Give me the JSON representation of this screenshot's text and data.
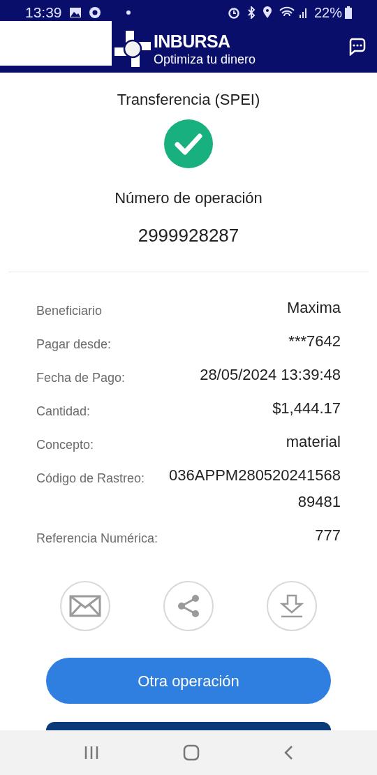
{
  "status_bar": {
    "time": "13:39",
    "battery": "22%"
  },
  "header": {
    "brand": "INBURSA",
    "tagline": "Optimiza tu dinero"
  },
  "receipt": {
    "title": "Transferencia (SPEI)",
    "operation_label": "Número de operación",
    "operation_number": "2999928287"
  },
  "details": [
    {
      "label": "Beneficiario",
      "value": "Maxima"
    },
    {
      "label": "Pagar desde:",
      "value": "***7642"
    },
    {
      "label": "Fecha de Pago:",
      "value": "28/05/2024 13:39:48"
    },
    {
      "label": "Cantidad:",
      "value": "$1,444.17"
    },
    {
      "label": "Concepto:",
      "value": "material"
    },
    {
      "label": "Código de Rastreo:",
      "value": "036APPM28052024156889481"
    },
    {
      "label": "Referencia Numérica:",
      "value": "777"
    }
  ],
  "actions": [
    {
      "kind": "email"
    },
    {
      "kind": "share"
    },
    {
      "kind": "download"
    }
  ],
  "primary_button": "Otra operación"
}
